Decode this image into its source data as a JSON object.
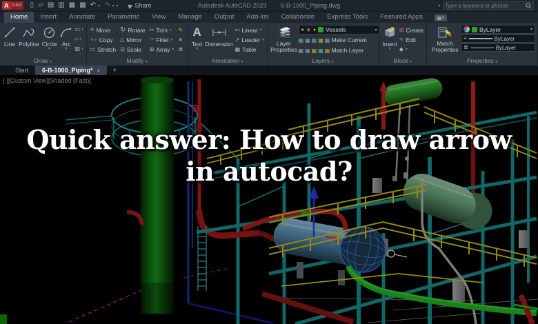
{
  "titlebar": {
    "logo_main": "A",
    "logo_sub": "CAD",
    "share_label": "Share",
    "app_title": "Autodesk AutoCAD 2023",
    "doc_title": "6-B-1000_Piping.dwg",
    "search_placeholder": "Type a keyword or phrase"
  },
  "ribbon": {
    "tabs": [
      "Home",
      "Insert",
      "Annotate",
      "Parametric",
      "View",
      "Manage",
      "Output",
      "Add-ins",
      "Collaborate",
      "Express Tools",
      "Featured Apps"
    ],
    "draw": {
      "label": "Draw",
      "line": "Line",
      "polyline": "Polyline",
      "circle": "Circle",
      "arc": "Arc"
    },
    "modify": {
      "label": "Modify",
      "move": "Move",
      "rotate": "Rotate",
      "trim": "Trim",
      "copy": "Copy",
      "mirror": "Mirror",
      "fillet": "Fillet",
      "stretch": "Stretch",
      "scale": "Scale",
      "array": "Array"
    },
    "annotation": {
      "label": "Annotation",
      "text": "Text",
      "dimension": "Dimension",
      "linear": "Linear",
      "leader": "Leader",
      "table": "Table"
    },
    "layers": {
      "label": "Layers",
      "layer_properties": "Layer Properties",
      "current_layer": "Vessels",
      "make_current": "Make Current",
      "match_layer": "Match Layer"
    },
    "block": {
      "label": "Block",
      "insert": "Insert",
      "create": "Create",
      "edit": "Edit"
    },
    "properties": {
      "label": "Properties",
      "match_properties": "Match Properties",
      "color_value": "ByLayer",
      "linetype_value": "ByLayer",
      "lineweight_value": "ByLayer"
    }
  },
  "filetabs": {
    "start": "Start",
    "doc": "6-B-1000_Piping*"
  },
  "viewport": {
    "controls": "[-][Custom View][Shaded (Fast)]"
  },
  "overlay": {
    "headline_line1": "Quick answer: How to draw arrow",
    "headline_line2": "in autocad?"
  },
  "icons": {
    "new": "▯",
    "open": "▱",
    "save": "▤",
    "save_as": "▥",
    "plot": "▦",
    "print": "▩",
    "undo": "↶",
    "redo": "↷",
    "dropdown": "▾",
    "share_plane": "▶",
    "move": "+",
    "rotate": "↻",
    "trim": "✂",
    "copy": "∘∘",
    "mirror": "△",
    "fillet": "◠",
    "stretch": "▭",
    "scale": "⊡",
    "array": "⊞",
    "erase": "✎",
    "explode": "∗",
    "offset": "≣",
    "text": "A",
    "dimension": "↔",
    "linear": "↤",
    "leader": "↗",
    "table": "▦",
    "rect": "▭",
    "ellipse": "○",
    "hatch": "▨",
    "bulb": "●",
    "sun": "☀",
    "lock": "●",
    "layer1": "▦",
    "layer2": "▦",
    "layer3": "▦",
    "layer4": "▦",
    "layer5": "▦",
    "create_block": "⊞",
    "edit_block": "✎",
    "attrib": "◆",
    "lines3": "≡",
    "lines3b": "≣"
  },
  "colors": {
    "accent_green": "#2e9e2e",
    "ribbon_bg": "#2b333c",
    "titlebar_bg": "#1d242c",
    "teal_structure": "#157d7d",
    "yellow_rail": "#b5a915",
    "red_pipe": "#9c1a1a",
    "headline": "#ffffff"
  }
}
